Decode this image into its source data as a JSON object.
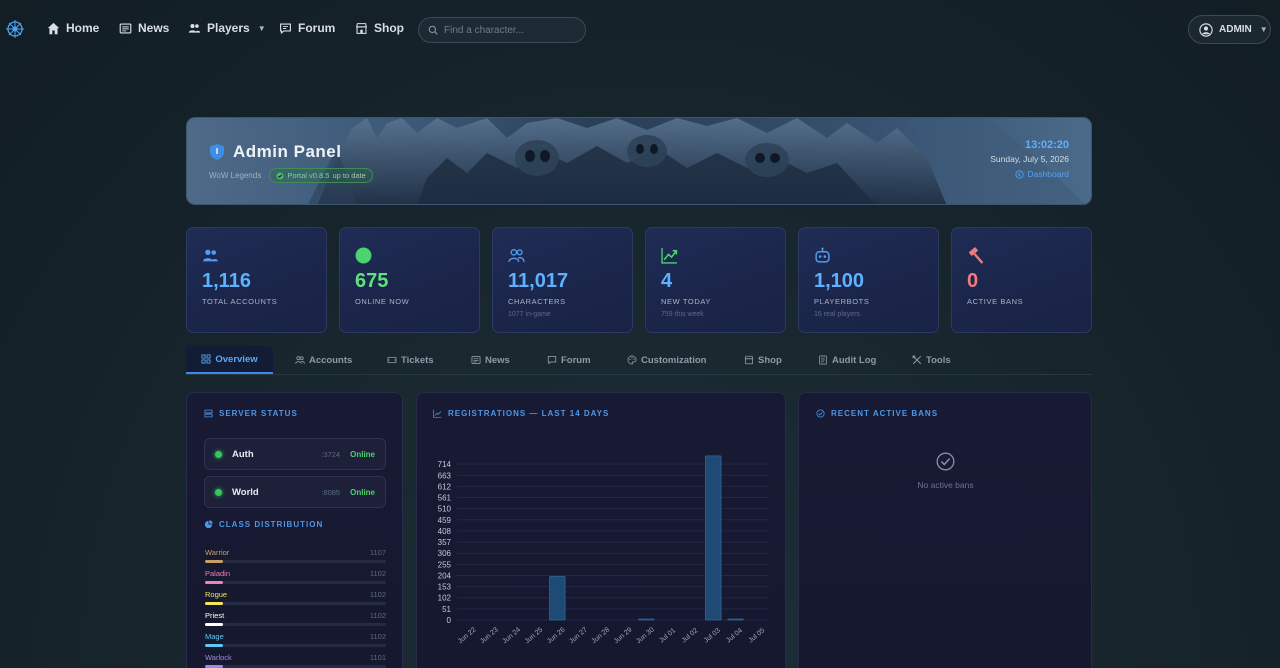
{
  "nav": {
    "items": [
      {
        "label": "Home",
        "icon": "home-icon"
      },
      {
        "label": "News",
        "icon": "news-icon"
      },
      {
        "label": "Players",
        "icon": "players-icon"
      },
      {
        "label": "Forum",
        "icon": "forum-icon"
      },
      {
        "label": "Shop",
        "icon": "shop-icon"
      }
    ],
    "search_placeholder": "Find a character...",
    "user_label": "ADMIN"
  },
  "banner": {
    "title": "Admin Panel",
    "realm": "WoW Legends",
    "version": "Portal v0.8.5",
    "version_status": "up to date",
    "time": "13:02:20",
    "date": "Sunday, July 5, 2026",
    "dashboard_link": "Dashboard"
  },
  "stats": [
    {
      "value": "1,116",
      "label": "TOTAL ACCOUNTS",
      "sub": "",
      "icon": "users-icon",
      "value_color": "#5db1ff",
      "icon_color": "#4f9cf0"
    },
    {
      "value": "675",
      "label": "ONLINE NOW",
      "sub": "",
      "icon": "online-dot-icon",
      "value_color": "#5ee27a",
      "icon_color": "#4cd26e"
    },
    {
      "value": "11,017",
      "label": "CHARACTERS",
      "sub": "1077 in-game",
      "icon": "characters-icon",
      "value_color": "#5db1ff",
      "icon_color": "#4f9cf0"
    },
    {
      "value": "4",
      "label": "NEW TODAY",
      "sub": "759 this week",
      "icon": "trend-up-icon",
      "value_color": "#5db1ff",
      "icon_color": "#4cd26e"
    },
    {
      "value": "1,100",
      "label": "PLAYERBOTS",
      "sub": "16 real players",
      "icon": "robot-icon",
      "value_color": "#5db1ff",
      "icon_color": "#4f9cf0"
    },
    {
      "value": "0",
      "label": "ACTIVE BANS",
      "sub": "",
      "icon": "ban-hammer-icon",
      "value_color": "#f07a80",
      "icon_color": "#f07a80"
    }
  ],
  "tabs": [
    {
      "label": "Overview",
      "icon": "grid-icon",
      "active": true
    },
    {
      "label": "Accounts",
      "icon": "users-icon"
    },
    {
      "label": "Tickets",
      "icon": "ticket-icon"
    },
    {
      "label": "News",
      "icon": "news-icon"
    },
    {
      "label": "Forum",
      "icon": "forum-icon"
    },
    {
      "label": "Customization",
      "icon": "palette-icon"
    },
    {
      "label": "Shop",
      "icon": "shop-icon"
    },
    {
      "label": "Audit Log",
      "icon": "audit-icon"
    },
    {
      "label": "Tools",
      "icon": "tools-icon"
    }
  ],
  "server_status": {
    "title": "SERVER STATUS",
    "servers": [
      {
        "name": "Auth",
        "port": ":3724",
        "status": "Online"
      },
      {
        "name": "World",
        "port": ":8085",
        "status": "Online"
      }
    ]
  },
  "class_distribution": {
    "title": "CLASS DISTRIBUTION",
    "classes": [
      {
        "name": "Warrior",
        "count": "1107",
        "color": "#c9a063",
        "fraction": 0.1
      },
      {
        "name": "Paladin",
        "count": "1102",
        "color": "#ef7fbd",
        "fraction": 0.1
      },
      {
        "name": "Rogue",
        "count": "1102",
        "color": "#f2e75a",
        "fraction": 0.1
      },
      {
        "name": "Priest",
        "count": "1102",
        "color": "#ffffff",
        "fraction": 0.1
      },
      {
        "name": "Mage",
        "count": "1102",
        "color": "#5fc8f0",
        "fraction": 0.1
      },
      {
        "name": "Warlock",
        "count": "1101",
        "color": "#9d8ae0",
        "fraction": 0.1
      }
    ]
  },
  "registrations": {
    "title": "REGISTRATIONS — LAST 14 DAYS"
  },
  "chart_data": {
    "type": "bar",
    "categories": [
      "Jun 22",
      "Jun 23",
      "Jun 24",
      "Jun 25",
      "Jun 26",
      "Jun 27",
      "Jun 28",
      "Jun 29",
      "Jun 30",
      "Jul 01",
      "Jul 02",
      "Jul 03",
      "Jul 04",
      "Jul 05"
    ],
    "values": [
      0,
      0,
      0,
      0,
      200,
      0,
      0,
      0,
      2,
      0,
      0,
      752,
      4,
      0
    ],
    "y_ticks": [
      "714",
      "663",
      "612",
      "561",
      "510",
      "459",
      "408",
      "357",
      "306",
      "255",
      "204",
      "153",
      "102",
      "51",
      "0"
    ],
    "ylim": [
      0,
      765
    ],
    "grid": true,
    "bar_color": "#1f4a75"
  },
  "recent_bans": {
    "title": "RECENT ACTIVE BANS",
    "empty_text": "No active bans"
  }
}
